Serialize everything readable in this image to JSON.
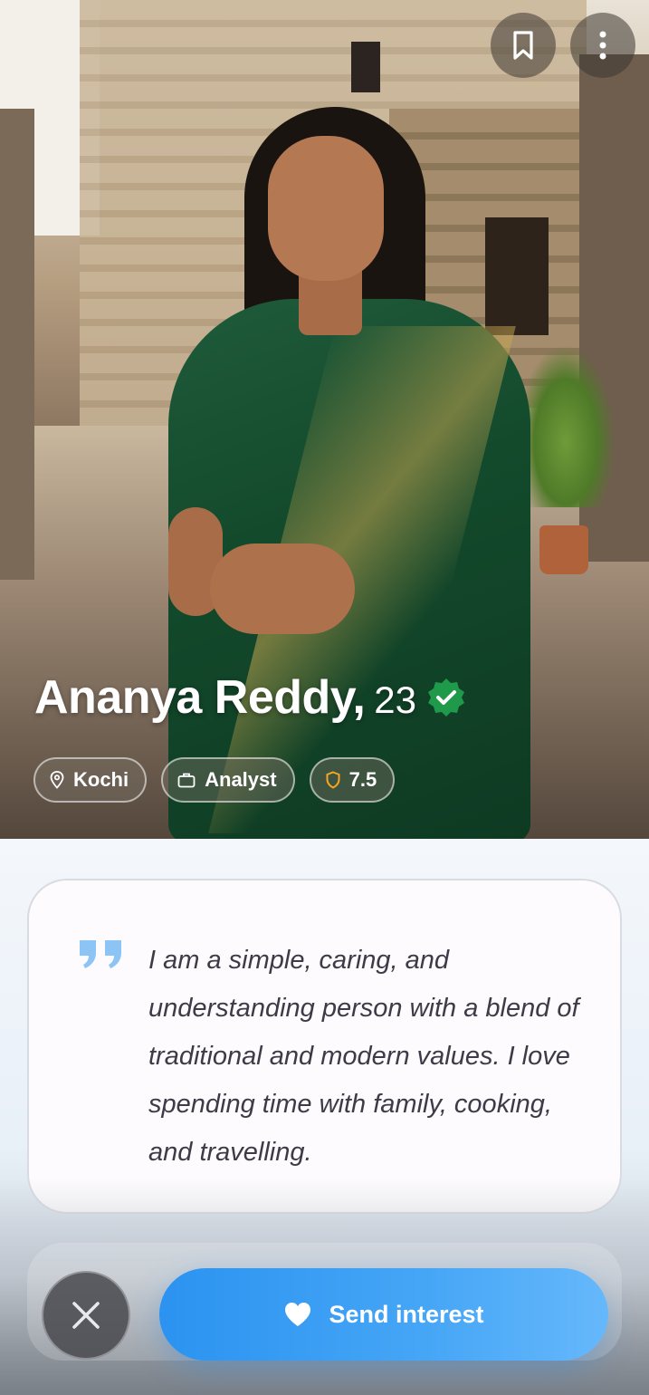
{
  "profile": {
    "name": "Ananya Reddy,",
    "age": "23",
    "verified": true,
    "chips": {
      "location": "Kochi",
      "occupation": "Analyst",
      "score": "7.5"
    },
    "bio": "I am a simple, caring, and understanding person with a blend of traditional and modern values. I love spending time with family, cooking, and travelling."
  },
  "actions": {
    "send_interest_label": "Send interest"
  },
  "icons": {
    "bookmark": "bookmark-icon",
    "more": "more-vertical-icon",
    "verified": "verified-check-icon",
    "location": "location-pin-icon",
    "briefcase": "briefcase-icon",
    "shield": "shield-icon",
    "quote": "quote-icon",
    "close": "close-icon",
    "heart": "heart-icon"
  },
  "colors": {
    "primary": "#3a9cf2",
    "verified": "#1f9a4a",
    "score_accent": "#f5a623",
    "quote": "#8cc4f5",
    "bio_text": "#3e3b48"
  }
}
